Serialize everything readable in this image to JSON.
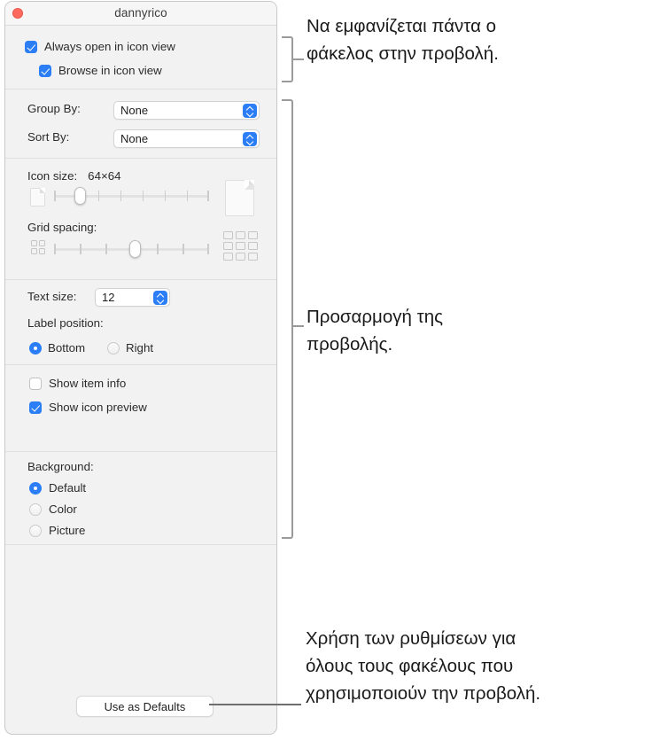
{
  "window": {
    "title": "dannyrico",
    "close_button": "close-button"
  },
  "view_options": {
    "checkboxes": [
      {
        "label": "Always open in icon view",
        "checked": true
      },
      {
        "label": "Browse in icon view",
        "checked": true
      }
    ],
    "group_by": {
      "label": "Group By:",
      "value": "None"
    },
    "sort_by": {
      "label": "Sort By:",
      "value": "None"
    },
    "icon_size": {
      "label": "Icon size:",
      "value": "64×64",
      "slider": {
        "ticks": 8,
        "thumb_percent": 17,
        "min_icon": "small-document-icon",
        "max_icon": "large-document-icon"
      }
    },
    "grid_spacing": {
      "label": "Grid spacing:",
      "slider": {
        "ticks": 7,
        "thumb_percent": 52,
        "min_icon": "small-grid-icon",
        "max_icon": "large-grid-icon"
      }
    },
    "text_size": {
      "label": "Text size:",
      "value": "12"
    },
    "label_position": {
      "label": "Label position:",
      "options": [
        {
          "label": "Bottom",
          "selected": true
        },
        {
          "label": "Right",
          "selected": false
        }
      ]
    },
    "display_checkboxes": [
      {
        "label": "Show item info",
        "checked": false
      },
      {
        "label": "Show icon preview",
        "checked": true
      }
    ],
    "background": {
      "label": "Background:",
      "options": [
        {
          "label": "Default",
          "selected": true
        },
        {
          "label": "Color",
          "selected": false
        },
        {
          "label": "Picture",
          "selected": false
        }
      ]
    },
    "use_as_defaults_button": "Use as Defaults"
  },
  "callouts": [
    {
      "text": "Να εμφανίζεται πάντα ο\nφάκελος στην προβολή."
    },
    {
      "text": "Προσαρμογή της\nπροβολής."
    },
    {
      "text": "Χρήση των ρυθμίσεων για\nόλους τους φακέλους που\nχρησιμοποιούν την προβολή."
    }
  ],
  "colors": {
    "accent": "#2b7ef5",
    "close": "#ff6a5e",
    "window_bg": "#f2f2f2",
    "callout_line": "#9a9a9a"
  }
}
